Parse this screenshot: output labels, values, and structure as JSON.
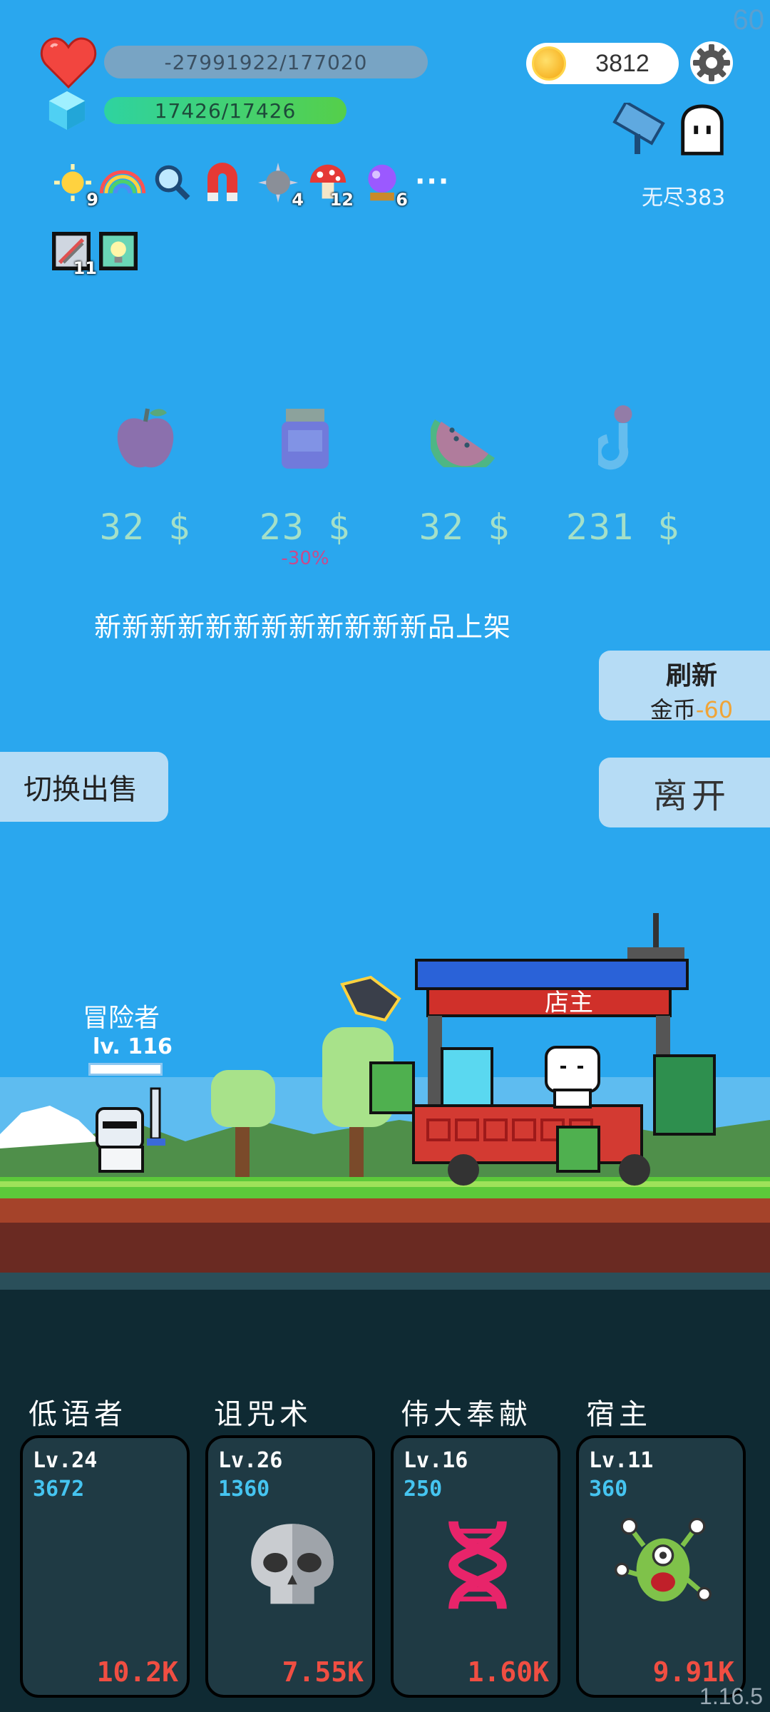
{
  "fps": "60",
  "hud": {
    "hp_text": "-27991922/177020",
    "mana_text": "17426/17426",
    "coins": "3812",
    "mode_label": "无尽383"
  },
  "buffs": [
    {
      "icon": "sun-icon",
      "count": "9"
    },
    {
      "icon": "rainbow-icon",
      "count": ""
    },
    {
      "icon": "magnifier-icon",
      "count": ""
    },
    {
      "icon": "magnet-icon",
      "count": ""
    },
    {
      "icon": "spiked-ball-icon",
      "count": "4"
    },
    {
      "icon": "mushroom-icon",
      "count": "12"
    },
    {
      "icon": "crystal-ball-icon",
      "count": "6"
    }
  ],
  "more_label": "···",
  "buffs_row2": [
    {
      "icon": "scroll-icon",
      "count": "11"
    },
    {
      "icon": "lightbulb-icon",
      "count": ""
    }
  ],
  "shop": {
    "items": [
      {
        "icon": "apple-icon",
        "price": "32 $",
        "discount": ""
      },
      {
        "icon": "jam-jar-icon",
        "price": "23 $",
        "discount": "-30%"
      },
      {
        "icon": "watermelon-icon",
        "price": "32 $",
        "discount": ""
      },
      {
        "icon": "hook-icon",
        "price": "231 $",
        "discount": ""
      }
    ],
    "banner": "新新新新新新新新新新新新品上架",
    "refresh_label": "刷新",
    "refresh_cost_label": "金币",
    "refresh_cost": "-60",
    "switch_label": "切换出售",
    "leave_label": "离开",
    "shopkeeper_label": "店主"
  },
  "adventurer": {
    "name": "冒险者",
    "level": "lv. 116"
  },
  "skills": [
    {
      "name": "低语者",
      "level": "Lv.24",
      "points": "3672",
      "cost": "10.2K",
      "icon": "crescent-moon-icon"
    },
    {
      "name": "诅咒术",
      "level": "Lv.26",
      "points": "1360",
      "cost": "7.55K",
      "icon": "skull-icon"
    },
    {
      "name": "伟大奉献",
      "level": "Lv.16",
      "points": "250",
      "cost": "1.60K",
      "icon": "dna-icon"
    },
    {
      "name": "宿主",
      "level": "Lv.11",
      "points": "360",
      "cost": "9.91K",
      "icon": "green-monster-icon"
    }
  ],
  "version": "1.16.5",
  "colors": {
    "sky": "#2aa7ee",
    "grass": "#5cc93a",
    "dirt": "#a5432a",
    "panel": "#0f2a33",
    "accent_cost": "#f04e42"
  }
}
